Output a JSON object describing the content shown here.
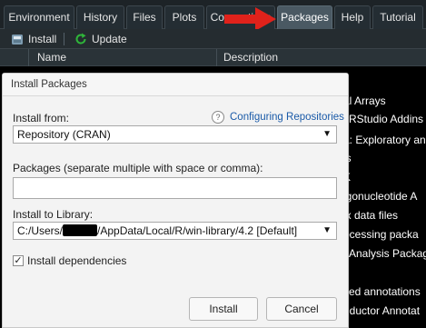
{
  "tabs": [
    {
      "label": "Environment",
      "active": false
    },
    {
      "label": "History",
      "active": false
    },
    {
      "label": "Files",
      "active": false
    },
    {
      "label": "Plots",
      "active": false
    },
    {
      "label": "Connections",
      "active": false
    },
    {
      "label": "Packages",
      "active": true
    },
    {
      "label": "Help",
      "active": false
    },
    {
      "label": "Tutorial",
      "active": false
    }
  ],
  "toolbar": {
    "install_label": "Install",
    "update_label": "Update"
  },
  "table": {
    "col_name": "Name",
    "col_description": "Description"
  },
  "background_rows": [
    "al Arrays",
    "RStudio Addins",
    "a: Exploratory and",
    "ls",
    "K",
    "igonucleotide A",
    "ix data files",
    "ocessing packa",
    "Analysis Package",
    "s",
    "sed annotations",
    "nductor Annotat"
  ],
  "dialog": {
    "title": "Install Packages",
    "install_from_label": "Install from:",
    "configuring_link": "Configuring Repositories",
    "install_from_value": "Repository (CRAN)",
    "packages_label": "Packages (separate multiple with space or comma):",
    "packages_value": "",
    "install_to_label": "Install to Library:",
    "library_prefix": "C:/Users/",
    "library_suffix": "/AppData/Local/R/win-library/4.2 [Default]",
    "install_dependencies_label": "Install dependencies",
    "install_dependencies_checked": true,
    "install_button": "Install",
    "cancel_button": "Cancel"
  },
  "colors": {
    "active_tab": "#4a5963",
    "link": "#1a5aa8",
    "arrow": "#e0221b",
    "update_icon": "#2fb53a"
  }
}
